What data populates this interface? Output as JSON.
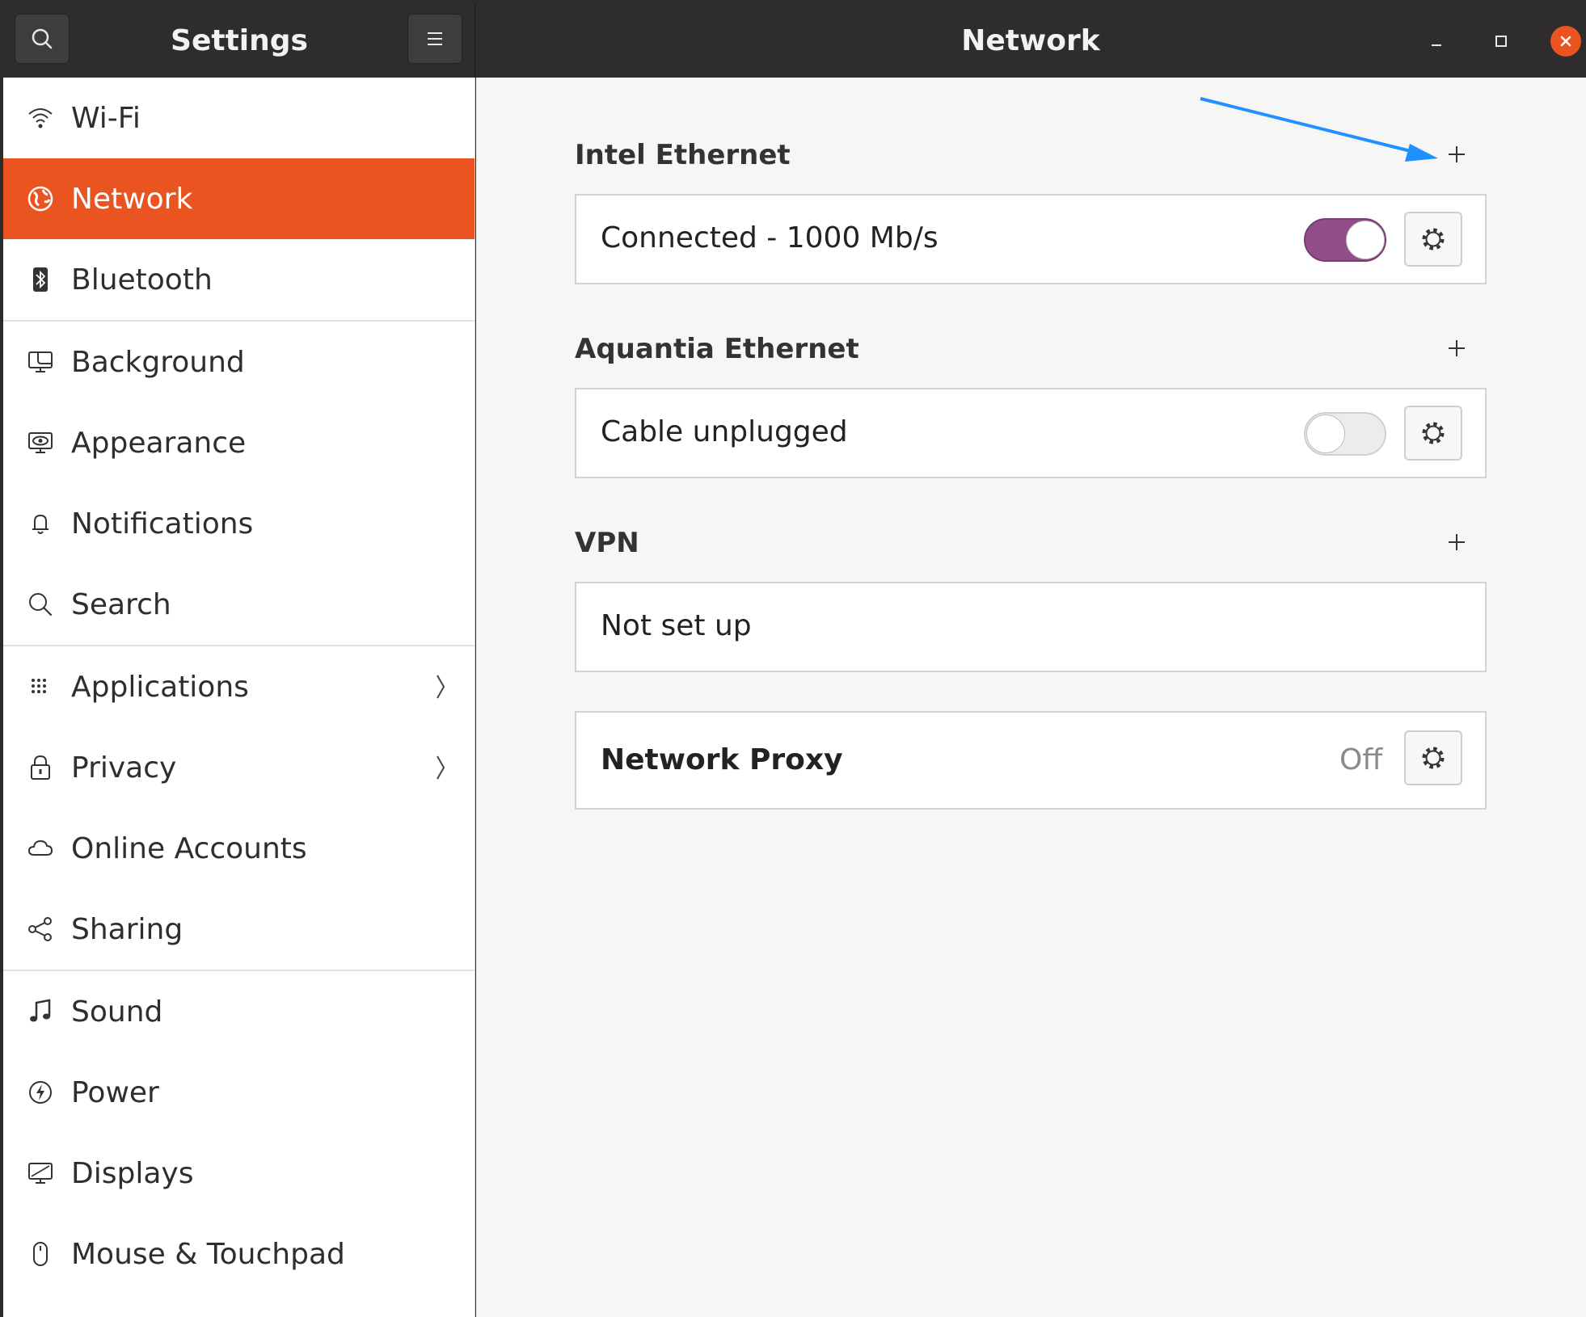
{
  "header": {
    "sidebar_title": "Settings",
    "page_title": "Network"
  },
  "sidebar": {
    "items": [
      {
        "label": "Wi-Fi",
        "icon": "wifi-icon"
      },
      {
        "label": "Network",
        "icon": "network-icon",
        "active": true
      },
      {
        "label": "Bluetooth",
        "icon": "bluetooth-icon"
      },
      {
        "label": "Background",
        "icon": "background-icon"
      },
      {
        "label": "Appearance",
        "icon": "appearance-icon"
      },
      {
        "label": "Notifications",
        "icon": "bell-icon"
      },
      {
        "label": "Search",
        "icon": "search-icon"
      },
      {
        "label": "Applications",
        "icon": "apps-grid-icon",
        "submenu": true
      },
      {
        "label": "Privacy",
        "icon": "lock-icon",
        "submenu": true
      },
      {
        "label": "Online Accounts",
        "icon": "cloud-icon"
      },
      {
        "label": "Sharing",
        "icon": "share-icon"
      },
      {
        "label": "Sound",
        "icon": "music-note-icon"
      },
      {
        "label": "Power",
        "icon": "power-icon"
      },
      {
        "label": "Displays",
        "icon": "display-icon"
      },
      {
        "label": "Mouse & Touchpad",
        "icon": "mouse-icon"
      }
    ]
  },
  "sections": {
    "intel": {
      "title": "Intel Ethernet",
      "status": "Connected - 1000 Mb/s",
      "toggle_on": true
    },
    "aquantia": {
      "title": "Aquantia Ethernet",
      "status": "Cable unplugged",
      "toggle_on": false
    },
    "vpn": {
      "title": "VPN",
      "status": "Not set up"
    },
    "proxy": {
      "label": "Network Proxy",
      "status": "Off"
    }
  },
  "colors": {
    "accent": "#e95420",
    "toggle_on": "#924d8b",
    "annotation_arrow": "#1e90ff"
  }
}
